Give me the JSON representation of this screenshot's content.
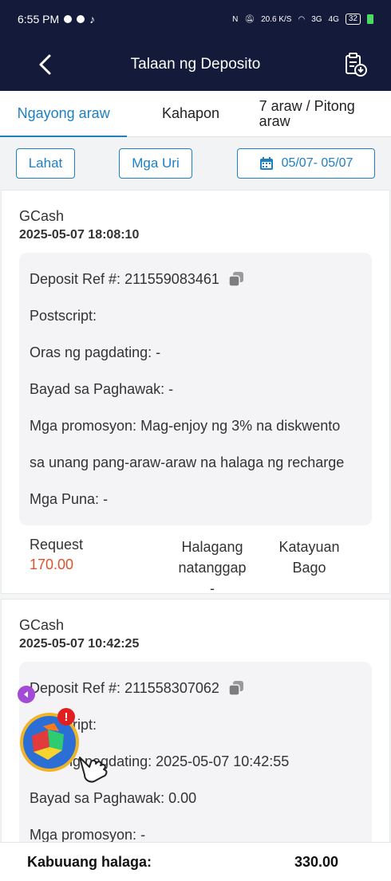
{
  "status_bar": {
    "time": "6:55 PM",
    "net_speed": "20.6 K/S",
    "signal1": "3G",
    "signal2": "4G",
    "battery": "32"
  },
  "header": {
    "title": "Talaan ng Deposito"
  },
  "tabs": [
    {
      "label": "Ngayong araw",
      "active": true
    },
    {
      "label": "Kahapon",
      "active": false
    },
    {
      "label": "7 araw / Pitong araw",
      "active": false
    }
  ],
  "filters": {
    "all": "Lahat",
    "types": "Mga Uri",
    "date_range": "05/07- 05/07"
  },
  "labels": {
    "ref": "Deposit Ref #:",
    "postscript": "Postscript:",
    "arrival": "Oras ng pagdating:",
    "fee": "Bayad sa Paghawak:",
    "promo": "Mga promosyon:",
    "remarks": "Mga Puna:",
    "request": "Request",
    "received": "Halagang natanggap",
    "status": "Katayuan"
  },
  "records": [
    {
      "method": "GCash",
      "datetime": "2025-05-07 18:08:10",
      "ref": "211559083461",
      "postscript": "",
      "arrival": "-",
      "fee": "-",
      "promo_line1": "Mag-enjoy ng 3% na diskwento",
      "promo_line2": "sa unang pang-araw-araw na halaga ng recharge",
      "remarks": "-",
      "request": "170.00",
      "received": "-",
      "status": "Bago"
    },
    {
      "method": "GCash",
      "datetime": "2025-05-07 10:42:25",
      "ref": "211558307062",
      "postscript": "",
      "arrival": "2025-05-07 10:42:55",
      "fee": "0.00",
      "promo": "-"
    }
  ],
  "footer": {
    "label": "Kabuuang halaga:",
    "value": "330.00"
  },
  "colors": {
    "header_bg": "#141a3a",
    "accent": "#1e80c2",
    "amount": "#e0502a"
  }
}
